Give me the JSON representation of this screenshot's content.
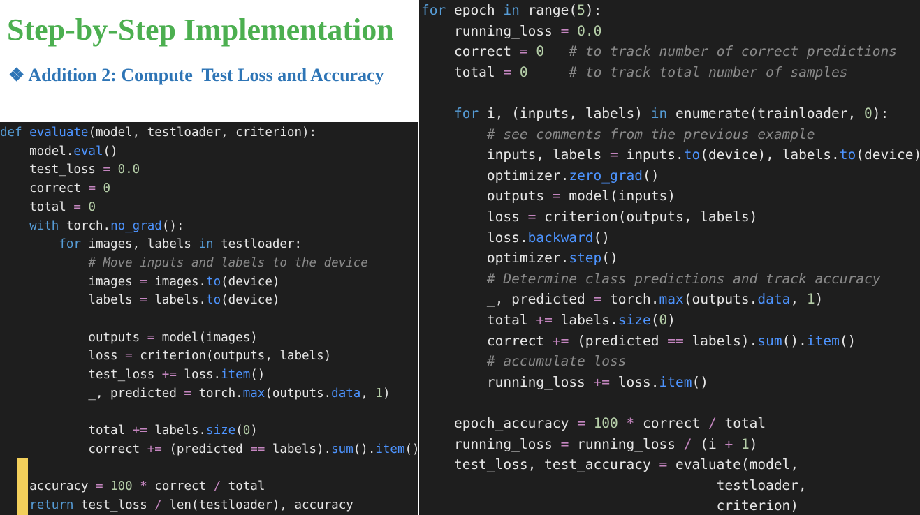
{
  "slide": {
    "title": "Step-by-Step Implementation",
    "subtitle": "❖ Addition 2: Compute  Test Loss and Accuracy"
  },
  "colors": {
    "title": "#4caf50",
    "subtitle": "#2e75b6",
    "code_background": "#1e1e1e",
    "keyword": "#569cd6",
    "function": "#4d94ff",
    "number": "#b5cea8",
    "operator": "#c586c0",
    "comment": "#8a8a8a",
    "text": "#e6e6e6",
    "highlight_bar": "#f2cf5b"
  },
  "left_code": {
    "lines": [
      [
        [
          "keyword",
          "def"
        ],
        [
          "plain",
          " "
        ],
        [
          "fn",
          "evaluate"
        ],
        [
          "plain",
          "(model, testloader, criterion):"
        ]
      ],
      [
        [
          "plain",
          "    model."
        ],
        [
          "fn",
          "eval"
        ],
        [
          "plain",
          "()"
        ]
      ],
      [
        [
          "plain",
          "    test_loss "
        ],
        [
          "op",
          "="
        ],
        [
          "plain",
          " "
        ],
        [
          "num",
          "0.0"
        ]
      ],
      [
        [
          "plain",
          "    correct "
        ],
        [
          "op",
          "="
        ],
        [
          "plain",
          " "
        ],
        [
          "num",
          "0"
        ]
      ],
      [
        [
          "plain",
          "    total "
        ],
        [
          "op",
          "="
        ],
        [
          "plain",
          " "
        ],
        [
          "num",
          "0"
        ]
      ],
      [
        [
          "plain",
          "    "
        ],
        [
          "keyword",
          "with"
        ],
        [
          "plain",
          " torch."
        ],
        [
          "fn",
          "no_grad"
        ],
        [
          "plain",
          "():"
        ]
      ],
      [
        [
          "plain",
          "        "
        ],
        [
          "keyword",
          "for"
        ],
        [
          "plain",
          " images, labels "
        ],
        [
          "keyword",
          "in"
        ],
        [
          "plain",
          " testloader:"
        ]
      ],
      [
        [
          "plain",
          "            "
        ],
        [
          "comment",
          "# Move inputs and labels to the device"
        ]
      ],
      [
        [
          "plain",
          "            images "
        ],
        [
          "op",
          "="
        ],
        [
          "plain",
          " images."
        ],
        [
          "fn",
          "to"
        ],
        [
          "plain",
          "(device)"
        ]
      ],
      [
        [
          "plain",
          "            labels "
        ],
        [
          "op",
          "="
        ],
        [
          "plain",
          " labels."
        ],
        [
          "fn",
          "to"
        ],
        [
          "plain",
          "(device)"
        ]
      ],
      [],
      [
        [
          "plain",
          "            outputs "
        ],
        [
          "op",
          "="
        ],
        [
          "plain",
          " model(images)"
        ]
      ],
      [
        [
          "plain",
          "            loss "
        ],
        [
          "op",
          "="
        ],
        [
          "plain",
          " criterion(outputs, labels)"
        ]
      ],
      [
        [
          "plain",
          "            test_loss "
        ],
        [
          "op",
          "+="
        ],
        [
          "plain",
          " loss."
        ],
        [
          "fn",
          "item"
        ],
        [
          "plain",
          "()"
        ]
      ],
      [
        [
          "plain",
          "            _, predicted "
        ],
        [
          "op",
          "="
        ],
        [
          "plain",
          " torch."
        ],
        [
          "fn",
          "max"
        ],
        [
          "plain",
          "(outputs."
        ],
        [
          "fn",
          "data"
        ],
        [
          "plain",
          ", "
        ],
        [
          "num",
          "1"
        ],
        [
          "plain",
          ")"
        ]
      ],
      [],
      [
        [
          "plain",
          "            total "
        ],
        [
          "op",
          "+="
        ],
        [
          "plain",
          " labels."
        ],
        [
          "fn",
          "size"
        ],
        [
          "plain",
          "("
        ],
        [
          "num",
          "0"
        ],
        [
          "plain",
          ")"
        ]
      ],
      [
        [
          "plain",
          "            correct "
        ],
        [
          "op",
          "+="
        ],
        [
          "plain",
          " (predicted "
        ],
        [
          "op",
          "=="
        ],
        [
          "plain",
          " labels)."
        ],
        [
          "fn",
          "sum"
        ],
        [
          "plain",
          "()."
        ],
        [
          "fn",
          "item"
        ],
        [
          "plain",
          "()"
        ]
      ],
      [],
      [
        [
          "plain",
          "    accuracy "
        ],
        [
          "op",
          "="
        ],
        [
          "plain",
          " "
        ],
        [
          "num",
          "100"
        ],
        [
          "plain",
          " "
        ],
        [
          "op",
          "*"
        ],
        [
          "plain",
          " correct "
        ],
        [
          "op",
          "/"
        ],
        [
          "plain",
          " total"
        ]
      ],
      [
        [
          "plain",
          "    "
        ],
        [
          "keyword",
          "return"
        ],
        [
          "plain",
          " test_loss "
        ],
        [
          "op",
          "/"
        ],
        [
          "plain",
          " len(testloader), accuracy"
        ]
      ]
    ]
  },
  "right_code": {
    "lines": [
      [
        [
          "keyword",
          "for"
        ],
        [
          "plain",
          " epoch "
        ],
        [
          "keyword",
          "in"
        ],
        [
          "plain",
          " range("
        ],
        [
          "num",
          "5"
        ],
        [
          "plain",
          "):"
        ]
      ],
      [
        [
          "plain",
          "    running_loss "
        ],
        [
          "op",
          "="
        ],
        [
          "plain",
          " "
        ],
        [
          "num",
          "0.0"
        ]
      ],
      [
        [
          "plain",
          "    correct "
        ],
        [
          "op",
          "="
        ],
        [
          "plain",
          " "
        ],
        [
          "num",
          "0"
        ],
        [
          "plain",
          "   "
        ],
        [
          "comment",
          "# to track number of correct predictions"
        ]
      ],
      [
        [
          "plain",
          "    total "
        ],
        [
          "op",
          "="
        ],
        [
          "plain",
          " "
        ],
        [
          "num",
          "0"
        ],
        [
          "plain",
          "     "
        ],
        [
          "comment",
          "# to track total number of samples"
        ]
      ],
      [],
      [
        [
          "plain",
          "    "
        ],
        [
          "keyword",
          "for"
        ],
        [
          "plain",
          " i, (inputs, labels) "
        ],
        [
          "keyword",
          "in"
        ],
        [
          "plain",
          " enumerate(trainloader, "
        ],
        [
          "num",
          "0"
        ],
        [
          "plain",
          "):"
        ]
      ],
      [
        [
          "plain",
          "        "
        ],
        [
          "comment",
          "# see comments from the previous example"
        ]
      ],
      [
        [
          "plain",
          "        inputs, labels "
        ],
        [
          "op",
          "="
        ],
        [
          "plain",
          " inputs."
        ],
        [
          "fn",
          "to"
        ],
        [
          "plain",
          "(device), labels."
        ],
        [
          "fn",
          "to"
        ],
        [
          "plain",
          "(device)"
        ]
      ],
      [
        [
          "plain",
          "        optimizer."
        ],
        [
          "fn",
          "zero_grad"
        ],
        [
          "plain",
          "()"
        ]
      ],
      [
        [
          "plain",
          "        outputs "
        ],
        [
          "op",
          "="
        ],
        [
          "plain",
          " model(inputs)"
        ]
      ],
      [
        [
          "plain",
          "        loss "
        ],
        [
          "op",
          "="
        ],
        [
          "plain",
          " criterion(outputs, labels)"
        ]
      ],
      [
        [
          "plain",
          "        loss."
        ],
        [
          "fn",
          "backward"
        ],
        [
          "plain",
          "()"
        ]
      ],
      [
        [
          "plain",
          "        optimizer."
        ],
        [
          "fn",
          "step"
        ],
        [
          "plain",
          "()"
        ]
      ],
      [
        [
          "plain",
          "        "
        ],
        [
          "comment",
          "# Determine class predictions and track accuracy"
        ]
      ],
      [
        [
          "plain",
          "        _, predicted "
        ],
        [
          "op",
          "="
        ],
        [
          "plain",
          " torch."
        ],
        [
          "fn",
          "max"
        ],
        [
          "plain",
          "(outputs."
        ],
        [
          "fn",
          "data"
        ],
        [
          "plain",
          ", "
        ],
        [
          "num",
          "1"
        ],
        [
          "plain",
          ")"
        ]
      ],
      [
        [
          "plain",
          "        total "
        ],
        [
          "op",
          "+="
        ],
        [
          "plain",
          " labels."
        ],
        [
          "fn",
          "size"
        ],
        [
          "plain",
          "("
        ],
        [
          "num",
          "0"
        ],
        [
          "plain",
          ")"
        ]
      ],
      [
        [
          "plain",
          "        correct "
        ],
        [
          "op",
          "+="
        ],
        [
          "plain",
          " (predicted "
        ],
        [
          "op",
          "=="
        ],
        [
          "plain",
          " labels)."
        ],
        [
          "fn",
          "sum"
        ],
        [
          "plain",
          "()."
        ],
        [
          "fn",
          "item"
        ],
        [
          "plain",
          "()"
        ]
      ],
      [
        [
          "plain",
          "        "
        ],
        [
          "comment",
          "# accumulate loss"
        ]
      ],
      [
        [
          "plain",
          "        running_loss "
        ],
        [
          "op",
          "+="
        ],
        [
          "plain",
          " loss."
        ],
        [
          "fn",
          "item"
        ],
        [
          "plain",
          "()"
        ]
      ],
      [],
      [
        [
          "plain",
          "    epoch_accuracy "
        ],
        [
          "op",
          "="
        ],
        [
          "plain",
          " "
        ],
        [
          "num",
          "100"
        ],
        [
          "plain",
          " "
        ],
        [
          "op",
          "*"
        ],
        [
          "plain",
          " correct "
        ],
        [
          "op",
          "/"
        ],
        [
          "plain",
          " total"
        ]
      ],
      [
        [
          "plain",
          "    running_loss "
        ],
        [
          "op",
          "="
        ],
        [
          "plain",
          " running_loss "
        ],
        [
          "op",
          "/"
        ],
        [
          "plain",
          " (i "
        ],
        [
          "op",
          "+"
        ],
        [
          "plain",
          " "
        ],
        [
          "num",
          "1"
        ],
        [
          "plain",
          ")"
        ]
      ],
      [
        [
          "plain",
          "    test_loss, test_accuracy "
        ],
        [
          "op",
          "="
        ],
        [
          "plain",
          " evaluate(model,"
        ]
      ],
      [
        [
          "plain",
          "                                    testloader,"
        ]
      ],
      [
        [
          "plain",
          "                                    criterion)"
        ]
      ]
    ]
  }
}
